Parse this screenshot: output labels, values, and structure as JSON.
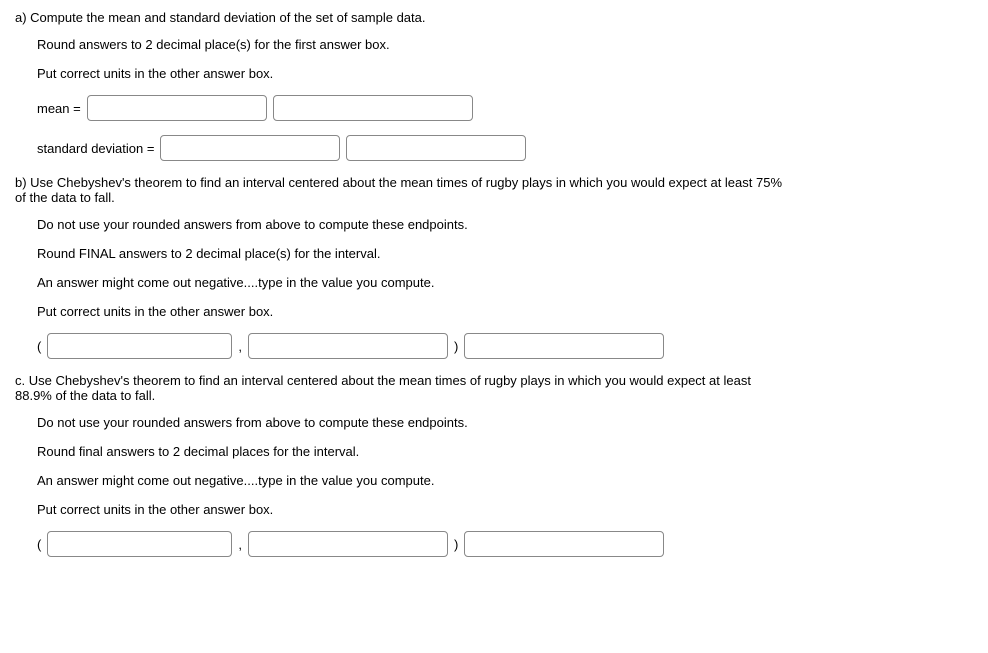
{
  "partA": {
    "header": "a) Compute the mean and standard deviation of the set of sample data.",
    "instruction1": "Round answers to 2 decimal place(s) for the first answer box.",
    "instruction2": "Put correct units in the other answer box.",
    "meanLabel": "mean =",
    "stdDevLabel": "standard deviation ="
  },
  "partB": {
    "header": "b) Use Chebyshev's theorem to find an interval centered about the mean times of rugby plays in which you would expect at least 75% of the data to fall.",
    "instruction1": "Do not use your rounded answers from above to compute these endpoints.",
    "instruction2": "Round FINAL answers to 2 decimal place(s) for the interval.",
    "instruction3": "An answer might come out negative....type in the value you compute.",
    "instruction4": "Put correct units in the other answer box.",
    "openParen": "(",
    "comma": ",",
    "closeParen": ")"
  },
  "partC": {
    "header": "c. Use Chebyshev's theorem to find an interval centered about the mean times of rugby plays in which you would expect at least 88.9% of the data to fall.",
    "instruction1": "Do not use your rounded answers from above to compute these endpoints.",
    "instruction2": "Round final answers to 2 decimal places for the interval.",
    "instruction3": "An answer might come out negative....type in the value you compute.",
    "instruction4": "Put correct units in the other answer box.",
    "openParen": "(",
    "comma": ",",
    "closeParen": ")"
  }
}
